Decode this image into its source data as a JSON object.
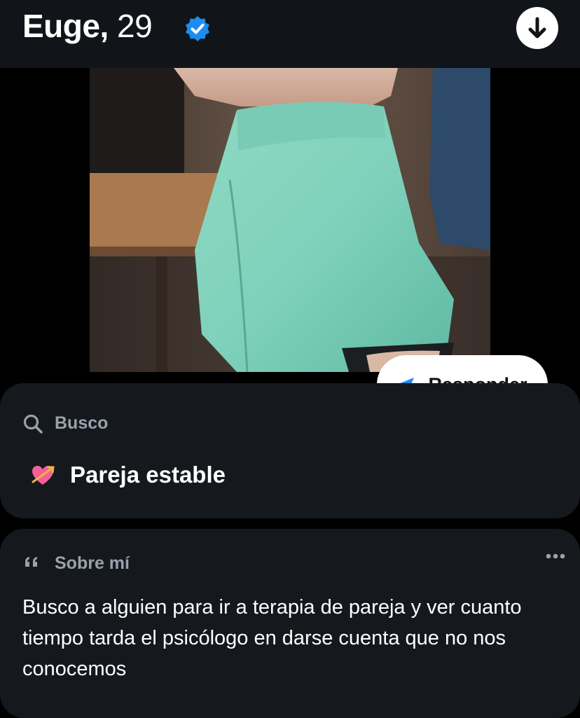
{
  "header": {
    "name": "Euge,",
    "age": "29",
    "verified_icon": "verified-badge-icon",
    "download_icon": "arrow-down-icon",
    "accent_color": "#1d8cf0"
  },
  "photo": {
    "subject": "photo",
    "reply_label": "Responder",
    "reply_icon": "send-arrow-icon"
  },
  "looking_for": {
    "label": "Busco",
    "icon": "search-icon",
    "value_icon": "heart-arrow-icon",
    "value": "Pareja estable"
  },
  "about": {
    "label": "Sobre mí",
    "icon": "quote-icon",
    "more_icon": "more-dots-icon",
    "text": "Busco a alguien para ir a terapia de pareja y ver cuanto tiempo tarda el psicólogo en darse cuenta que no nos conocemos"
  }
}
